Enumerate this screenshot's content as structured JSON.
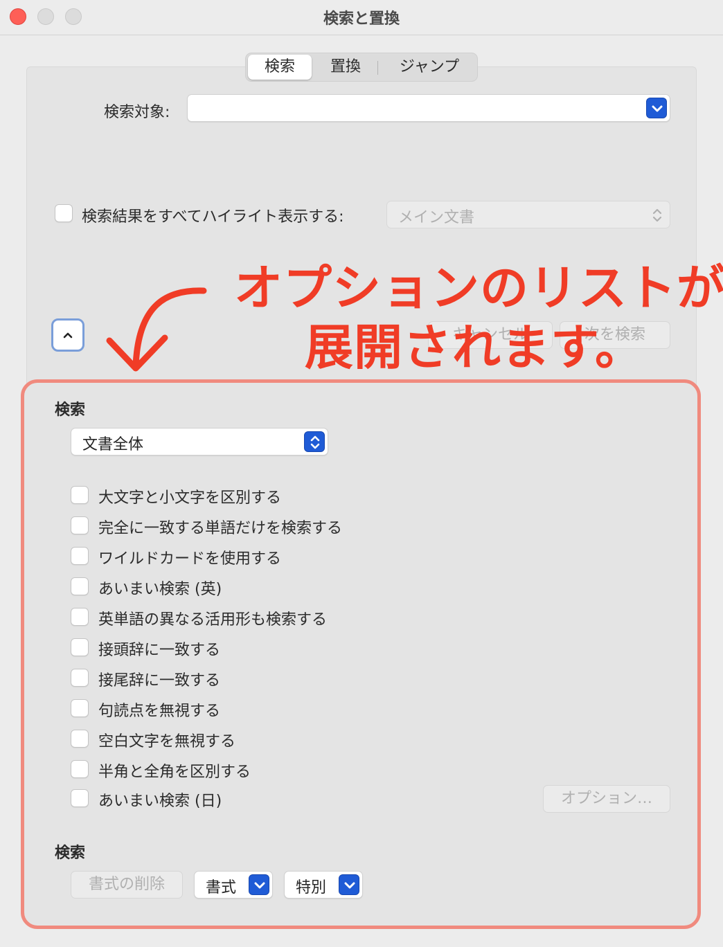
{
  "window": {
    "title": "検索と置換"
  },
  "tabs": [
    {
      "label": "検索",
      "active": true
    },
    {
      "label": "置換",
      "active": false
    },
    {
      "label": "ジャンプ",
      "active": false
    }
  ],
  "search_target": {
    "label": "検索対象:",
    "value": ""
  },
  "highlight": {
    "label": "検索結果をすべてハイライト表示する:",
    "checked": false,
    "select_value": "メイン文書"
  },
  "buttons": {
    "cancel": "キャンセル",
    "find_next": "次を検索",
    "options": "オプション…"
  },
  "annotation": {
    "line1": "オプションのリストが",
    "line2": "展開されます。",
    "color": "#f03c26"
  },
  "options": {
    "search_heading": "検索",
    "scope_value": "文書全体",
    "items": [
      {
        "label": "大文字と小文字を区別する",
        "checked": false
      },
      {
        "label": "完全に一致する単語だけを検索する",
        "checked": false
      },
      {
        "label": "ワイルドカードを使用する",
        "checked": false
      },
      {
        "label": "あいまい検索 (英)",
        "checked": false
      },
      {
        "label": "英単語の異なる活用形も検索する",
        "checked": false
      },
      {
        "label": "接頭辞に一致する",
        "checked": false
      },
      {
        "label": "接尾辞に一致する",
        "checked": false
      },
      {
        "label": "句読点を無視する",
        "checked": false
      },
      {
        "label": "空白文字を無視する",
        "checked": false
      },
      {
        "label": "半角と全角を区別する",
        "checked": false
      },
      {
        "label": "あいまい検索 (日)",
        "checked": false
      }
    ],
    "format_heading": "検索",
    "clear_format": "書式の削除",
    "format": "書式",
    "special": "特別"
  }
}
